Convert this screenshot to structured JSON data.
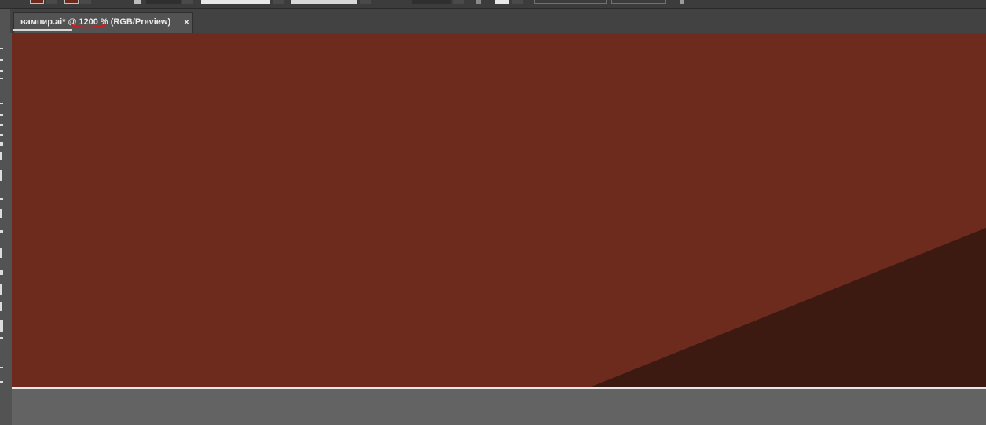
{
  "document_tab": {
    "title": "вампир.ai* @ 1200 % (RGB/Preview)",
    "close_glyph": "×",
    "close_icon": "close-icon"
  },
  "annotation": {
    "color": "#c8201e",
    "icon": "red-underline-mark"
  },
  "colors": {
    "canvas_fill": "#6d2b1d",
    "shadow_shape": "#3c1a12",
    "fill_swatch": "#6d2b1d",
    "ui_dark": "#3c3c3c",
    "pasteboard": "#636363"
  }
}
